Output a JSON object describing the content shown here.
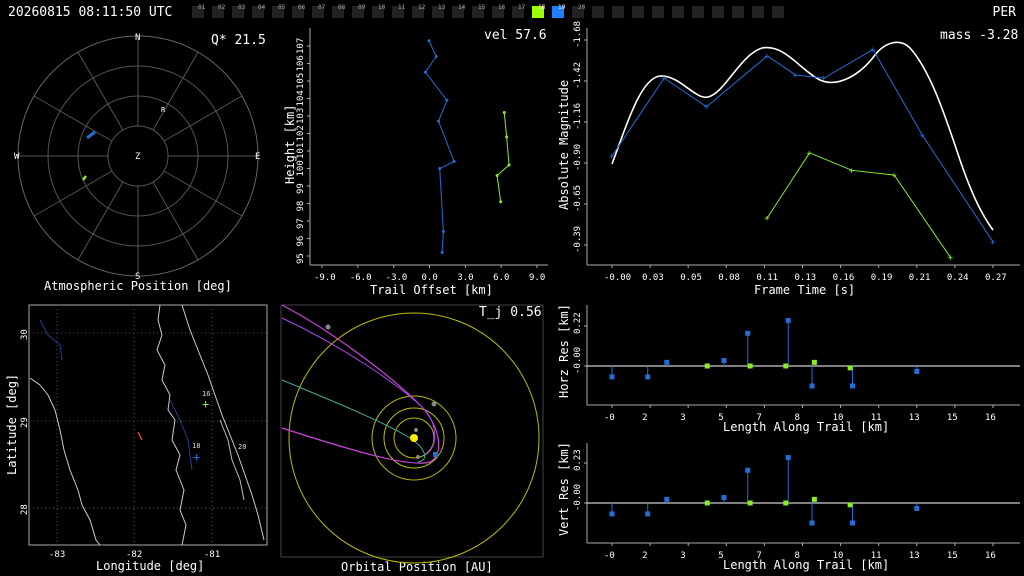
{
  "header": {
    "timestamp": "20260815 08:11:50 UTC",
    "station": "PER",
    "frames": [
      "01",
      "02",
      "03",
      "04",
      "05",
      "06",
      "07",
      "08",
      "09",
      "10",
      "11",
      "12",
      "13",
      "14",
      "15",
      "16",
      "17",
      "18",
      "19",
      "20"
    ],
    "active_frames": {
      "18": "#9cff00",
      "19": "#1f7fff"
    }
  },
  "colors": {
    "blue": "#1f6fd6",
    "green": "#88ee22",
    "grid": "#666666",
    "yellow": "#dddd00",
    "orbit_magenta": "#cc44dd",
    "orbit_teal": "#44aa99"
  },
  "polar": {
    "title": "Atmospheric Position [deg]",
    "readout": "Q* 21.5",
    "dirs": {
      "n": "N",
      "s": "S",
      "e": "E",
      "w": "W",
      "z": "Z",
      "r": "R"
    }
  },
  "height_plot": {
    "xlabel": "Trail Offset [km]",
    "ylabel": "Height [km]",
    "readout": "vel 57.6",
    "xticks": [
      "-9.0",
      "-6.0",
      "-3.0",
      "0.0",
      "3.0",
      "6.0",
      "9.0"
    ],
    "yticks": [
      "95",
      "96",
      "97",
      "98",
      "99",
      "100",
      "101",
      "102",
      "103",
      "104",
      "105",
      "106",
      "107"
    ]
  },
  "mag_plot": {
    "xlabel": "Frame Time [s]",
    "ylabel": "Absolute Magnitude",
    "readout": "mass -3.28",
    "xticks": [
      "-0.00",
      "0.03",
      "0.05",
      "0.08",
      "0.11",
      "0.13",
      "0.16",
      "0.19",
      "0.21",
      "0.24",
      "0.27"
    ],
    "yticks": [
      "-1.68",
      "-1.42",
      "-1.16",
      "-0.90",
      "-0.65",
      "-0.39"
    ]
  },
  "map_plot": {
    "xlabel": "Longitude [deg]",
    "ylabel": "Latitude [deg]",
    "xticks": [
      "-83",
      "-82",
      "-81"
    ],
    "yticks": [
      "30",
      "29",
      "28"
    ],
    "markers": [
      "16",
      "20",
      "18"
    ]
  },
  "orbit_plot": {
    "xlabel": "Orbital Position [AU]",
    "readout": "T_j 0.56"
  },
  "horz_plot": {
    "xlabel": "Length Along Trail [km]",
    "ylabel": "Horz Res [km]",
    "xticks": [
      "-0",
      "2",
      "3",
      "5",
      "7",
      "8",
      "10",
      "11",
      "13",
      "15",
      "16"
    ],
    "yticks": [
      "0.22",
      "-0.00"
    ]
  },
  "vert_plot": {
    "xlabel": "Length Along Trail [km]",
    "ylabel": "Vert Res [km]",
    "xticks": [
      "-0",
      "2",
      "3",
      "5",
      "7",
      "8",
      "10",
      "11",
      "13",
      "15",
      "16"
    ],
    "yticks": [
      "0.23",
      "-0.00"
    ]
  },
  "chart_data": [
    {
      "type": "line",
      "name_ref": "height_plot",
      "series": [
        {
          "color": "blue",
          "x": [
            0.0,
            0.6,
            -0.3,
            1.5,
            0.8,
            2.1,
            0.9,
            1.2,
            1.1
          ],
          "y": [
            107.3,
            106.4,
            105.5,
            103.9,
            102.7,
            100.4,
            100.0,
            96.4,
            95.2
          ]
        },
        {
          "color": "green",
          "x": [
            6.3,
            6.5,
            6.7,
            5.7,
            6.0
          ],
          "y": [
            103.2,
            101.8,
            100.2,
            99.6,
            98.1
          ]
        }
      ]
    },
    {
      "type": "line",
      "name_ref": "mag_plot",
      "series": [
        {
          "color": "blue",
          "x": [
            0.0,
            0.037,
            0.067,
            0.11,
            0.13,
            0.15,
            0.185,
            0.22,
            0.27
          ],
          "y": [
            -0.95,
            -1.44,
            -1.26,
            -1.58,
            -1.46,
            -1.44,
            -1.62,
            -1.08,
            -0.41
          ]
        },
        {
          "color": "green",
          "x": [
            0.11,
            0.14,
            0.17,
            0.2,
            0.24
          ],
          "y": [
            -0.56,
            -0.97,
            -0.86,
            -0.83,
            -0.31
          ]
        }
      ]
    },
    {
      "type": "scatter",
      "name_ref": "horz_plot",
      "series": [
        {
          "color": "blue",
          "x": [
            0.0,
            1.5,
            2.3,
            4.7,
            5.7,
            7.4,
            8.4,
            10.1,
            12.8
          ],
          "y": [
            -0.06,
            -0.06,
            0.02,
            0.03,
            0.18,
            0.25,
            -0.11,
            -0.11,
            -0.03
          ]
        },
        {
          "color": "green",
          "x": [
            4.0,
            5.8,
            7.3,
            8.5,
            10.0
          ],
          "y": [
            0.0,
            0.0,
            0.0,
            0.02,
            -0.01
          ]
        }
      ]
    },
    {
      "type": "scatter",
      "name_ref": "vert_plot",
      "series": [
        {
          "color": "blue",
          "x": [
            0.0,
            1.5,
            2.3,
            4.7,
            5.7,
            7.4,
            8.4,
            10.1,
            12.8
          ],
          "y": [
            -0.06,
            -0.06,
            0.02,
            0.03,
            0.18,
            0.25,
            -0.11,
            -0.11,
            -0.03
          ]
        },
        {
          "color": "green",
          "x": [
            4.0,
            5.8,
            7.3,
            8.5,
            10.0
          ],
          "y": [
            0.0,
            0.0,
            0.0,
            0.02,
            -0.01
          ]
        }
      ]
    }
  ]
}
